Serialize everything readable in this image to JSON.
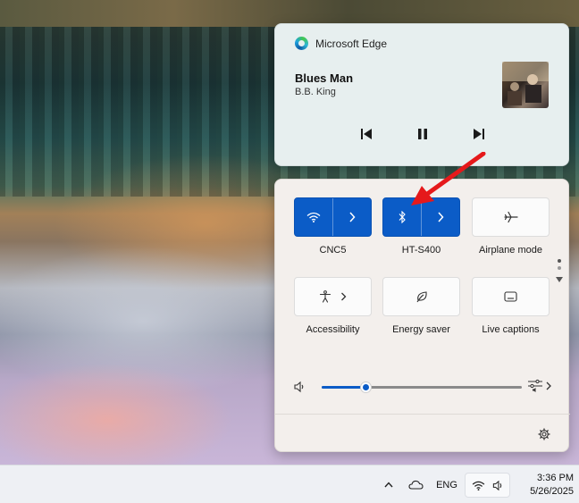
{
  "media": {
    "app_name": "Microsoft Edge",
    "title": "Blues Man",
    "artist": "B.B. King",
    "controls": {
      "previous": "previous-track-icon",
      "pause": "pause-icon",
      "next": "next-track-icon"
    }
  },
  "quick_settings": {
    "tiles": [
      {
        "label": "CNC5",
        "icon": "wifi-icon",
        "state": "on",
        "has_expand": true
      },
      {
        "label": "HT-S400",
        "icon": "bluetooth-icon",
        "state": "on",
        "has_expand": true
      },
      {
        "label": "Airplane mode",
        "icon": "airplane-icon",
        "state": "off",
        "has_expand": false
      },
      {
        "label": "Accessibility",
        "icon": "accessibility-icon",
        "state": "off",
        "has_expand": true
      },
      {
        "label": "Energy saver",
        "icon": "leaf-icon",
        "state": "off",
        "has_expand": false
      },
      {
        "label": "Live captions",
        "icon": "captions-icon",
        "state": "off",
        "has_expand": false
      }
    ],
    "volume": {
      "level": 0.22,
      "icon": "speaker-icon",
      "output_icon": "audio-output-icon"
    },
    "settings_icon": "gear-icon",
    "page_indicator": {
      "pages": 2,
      "current": 1
    }
  },
  "taskbar": {
    "language": "ENG",
    "time": "3:36 PM",
    "date": "5/26/2025"
  },
  "colors": {
    "accent": "#0b5cc7",
    "annotation": "#e5191b"
  }
}
